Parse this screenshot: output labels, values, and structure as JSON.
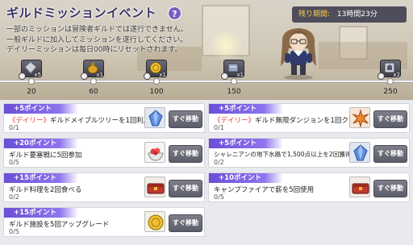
{
  "event": {
    "title": "ギルドミッションイベント",
    "help": "?",
    "description": [
      "一部のミッションは冒険者ギルドでは遂行できません。",
      "一般ギルドに加入してミッションを遂行してください。",
      "デイリーミッションは毎日00時にリセットされます。"
    ],
    "time_label": "残り期間:",
    "time_value": "13時間23分"
  },
  "progress": {
    "current": 0,
    "max": 250,
    "milestones": [
      20,
      60,
      100,
      150,
      250
    ],
    "rewards": [
      {
        "count": "x5",
        "icon": "gray-crystal-icon"
      },
      {
        "count": "x1",
        "icon": "gold-pouch-icon"
      },
      {
        "count": "x1",
        "icon": "gold-coin-icon"
      },
      {
        "count": "x1",
        "icon": "scroll-box-icon"
      },
      {
        "count": "x2",
        "icon": "emblem-box-icon"
      }
    ]
  },
  "missions": [
    {
      "points": "+5ポイント",
      "tag": "《デイリー》",
      "text": "ギルドメイプルツリーを1回利用",
      "progress": "0/1",
      "icon": "blue-crystal-icon",
      "button": "すぐ移動"
    },
    {
      "points": "+5ポイント",
      "tag": "《デイリー》",
      "text": "ギルド無限ダンジョンを1回クリア",
      "progress": "0/1",
      "icon": "sparkle-burst-icon",
      "button": "すぐ移動"
    },
    {
      "points": "+20ポイント",
      "tag": "",
      "text": "ギルド要塞戦に5回参加",
      "progress": "0/5",
      "icon": "fruit-bowl-icon",
      "button": "すぐ移動"
    },
    {
      "points": "+5ポイント",
      "tag": "",
      "text": "シャレニアンの地下水路で1,500点以上を2回獲得",
      "progress": "0/2",
      "icon": "blue-crystal-icon",
      "button": "すぐ移動"
    },
    {
      "points": "+15ポイント",
      "tag": "",
      "text": "ギルド料理を2回食べる",
      "progress": "0/2",
      "icon": "red-chest-icon",
      "button": "すぐ移動"
    },
    {
      "points": "+10ポイント",
      "tag": "",
      "text": "キャンプファイアで薪を5回使用",
      "progress": "0/5",
      "icon": "red-chest-icon",
      "button": "すぐ移動"
    },
    {
      "points": "+15ポイント",
      "tag": "",
      "text": "ギルド施設を5回アップグレード",
      "progress": "0/5",
      "icon": "gold-coin-icon",
      "button": "すぐ移動"
    }
  ],
  "colors": {
    "accent": "#7b5bc2",
    "points_bar": "#6a4ed8",
    "daily_tag": "#e03b3b",
    "button": "#6b6c78"
  }
}
